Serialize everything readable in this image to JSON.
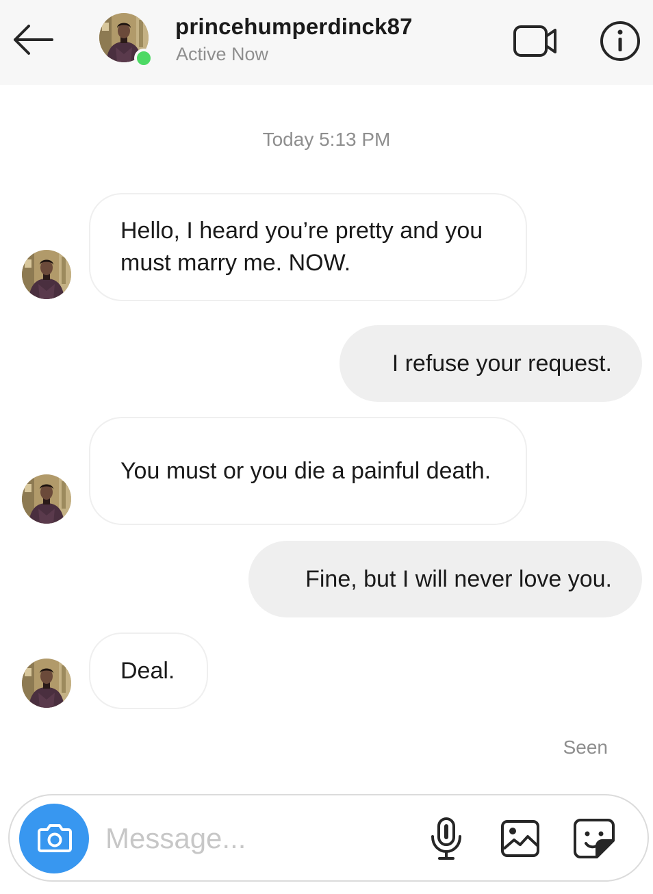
{
  "header": {
    "username": "princehumperdinck87",
    "status": "Active Now"
  },
  "icons": {
    "back": "back-arrow-icon",
    "video": "video-camera-icon",
    "info": "info-icon",
    "camera": "camera-icon",
    "mic": "microphone-icon",
    "gallery": "image-icon",
    "sticker": "sticker-icon"
  },
  "colors": {
    "online": "#4cd964",
    "camera_button": "#3897f0",
    "outgoing_bubble": "#efefef"
  },
  "thread": {
    "timestamp": "Today 5:13 PM",
    "messages": [
      {
        "from": "them",
        "text": "Hello, I heard you’re pretty and you must marry me. NOW."
      },
      {
        "from": "me",
        "text": "I refuse your request."
      },
      {
        "from": "them",
        "text": "You must or you die a painful death."
      },
      {
        "from": "me",
        "text": "Fine, but I will never love you."
      },
      {
        "from": "them",
        "text": "Deal."
      }
    ],
    "seen": "Seen"
  },
  "composer": {
    "placeholder": "Message..."
  }
}
